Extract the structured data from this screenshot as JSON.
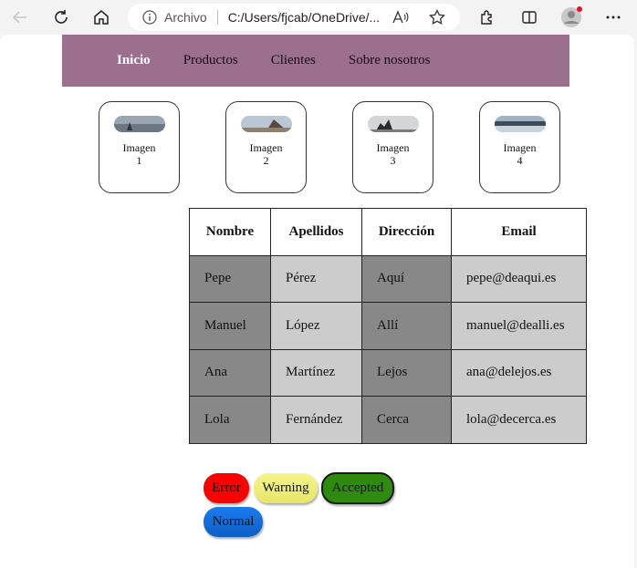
{
  "browser": {
    "archivo_label": "Archivo",
    "url": "C:/Users/fjcab/OneDrive/...",
    "profile_badge_color": "#e81123"
  },
  "nav": {
    "items": [
      {
        "label": "Inicio",
        "active": true
      },
      {
        "label": "Productos"
      },
      {
        "label": "Clientes"
      },
      {
        "label": "Sobre nosotros"
      }
    ],
    "bg": "#9c6f8f"
  },
  "cards": [
    {
      "label_line1": "Imagen",
      "label_line2": "1"
    },
    {
      "label_line1": "Imagen",
      "label_line2": "2"
    },
    {
      "label_line1": "Imagen",
      "label_line2": "3"
    },
    {
      "label_line1": "Imagen",
      "label_line2": "4"
    }
  ],
  "table": {
    "headers": [
      "Nombre",
      "Apellidos",
      "Dirección",
      "Email"
    ],
    "rows": [
      [
        "Pepe",
        "Pérez",
        "Aquí",
        "pepe@deaqui.es"
      ],
      [
        "Manuel",
        "López",
        "Allí",
        "manuel@dealli.es"
      ],
      [
        "Ana",
        "Martínez",
        "Lejos",
        "ana@delejos.es"
      ],
      [
        "Lola",
        "Fernández",
        "Cerca",
        "lola@decerca.es"
      ]
    ]
  },
  "buttons": {
    "error": "Error",
    "warning": "Warning",
    "accepted": "Accepted",
    "normal": "Normal"
  },
  "colors": {
    "error": "#ff0000",
    "warning": "#f0f07a",
    "accepted": "#2e8b0f",
    "normal": "#1573e6"
  }
}
